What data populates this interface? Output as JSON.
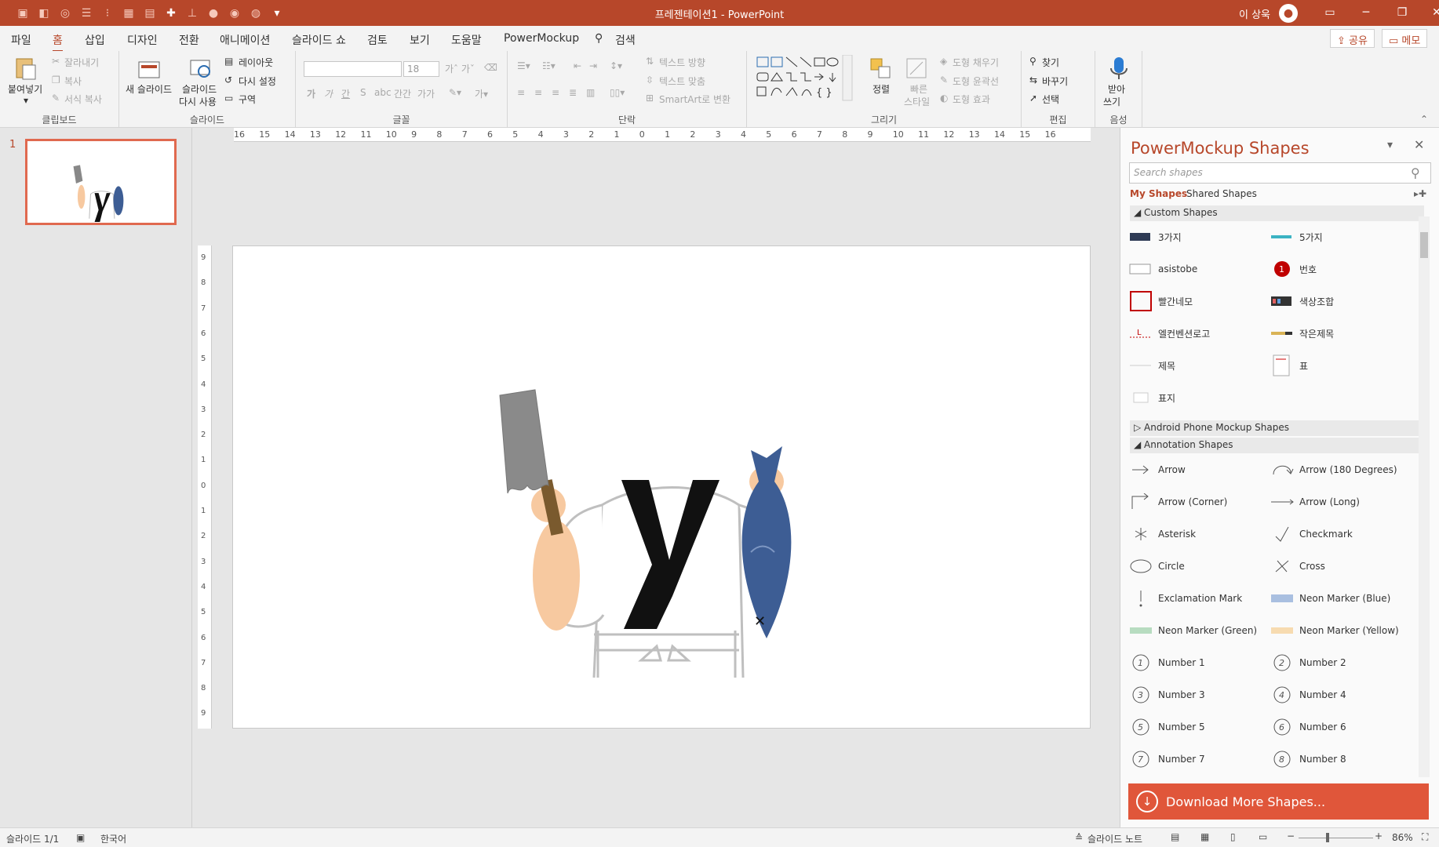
{
  "title": "프레젠테이션1  -  PowerPoint",
  "user": "이 상욱",
  "colors": {
    "accent": "#b7472a",
    "download_bg": "#e0563a"
  },
  "menu": {
    "items": [
      "파일",
      "홈",
      "삽입",
      "디자인",
      "전환",
      "애니메이션",
      "슬라이드 쇼",
      "검토",
      "보기",
      "도움말",
      "PowerMockup"
    ],
    "search": "검색",
    "share": "공유",
    "memo": "메모"
  },
  "ribbon": {
    "clipboard": {
      "label": "클립보드",
      "paste": "붙여넣기",
      "cut": "잘라내기",
      "copy": "복사",
      "format_painter": "서식 복사"
    },
    "slides": {
      "label": "슬라이드",
      "new_slide": "새 슬라이드",
      "reuse_line1": "슬라이드",
      "reuse_line2": "다시 사용",
      "layout": "레이아웃",
      "reset": "다시 설정",
      "section": "구역"
    },
    "font": {
      "label": "글꼴",
      "size": "18"
    },
    "paragraph": {
      "label": "단락",
      "text_direction": "텍스트 방향",
      "align_text": "텍스트 맞춤",
      "smartart": "SmartArt로 변환"
    },
    "drawing": {
      "label": "그리기",
      "arrange": "정렬",
      "quick_styles_line1": "빠른",
      "quick_styles_line2": "스타일",
      "shape_fill": "도형 채우기",
      "shape_outline": "도형 윤곽선",
      "shape_effects": "도형 효과"
    },
    "editing": {
      "label": "편집",
      "find": "찾기",
      "replace": "바꾸기",
      "select": "선택"
    },
    "voice": {
      "label": "음성",
      "dictate_line1": "받아",
      "dictate_line2": "쓰기"
    }
  },
  "thumbnail": {
    "number": "1"
  },
  "ruler": {
    "h_labels": [
      "16",
      "15",
      "14",
      "13",
      "12",
      "11",
      "10",
      "9",
      "8",
      "7",
      "6",
      "5",
      "4",
      "3",
      "2",
      "1",
      "0",
      "1",
      "2",
      "3",
      "4",
      "5",
      "6",
      "7",
      "8",
      "9",
      "10",
      "11",
      "12",
      "13",
      "14",
      "15",
      "16"
    ],
    "v_labels": [
      "9",
      "8",
      "7",
      "6",
      "5",
      "4",
      "3",
      "2",
      "1",
      "0",
      "1",
      "2",
      "3",
      "4",
      "5",
      "6",
      "7",
      "8",
      "9"
    ]
  },
  "panel": {
    "title": "PowerMockup Shapes",
    "search_placeholder": "Search shapes",
    "tab_my": "My Shapes",
    "tab_shared": "Shared Shapes",
    "section_custom": "Custom Shapes",
    "section_android": "Android Phone Mockup Shapes",
    "section_annotation": "Annotation Shapes",
    "custom": [
      "3가지",
      "5가지",
      "asistobe",
      "번호",
      "빨간네모",
      "색상조합",
      "엘컨벤션로고",
      "작은제목",
      "제목",
      "표",
      "표지"
    ],
    "annotation": [
      "Arrow",
      "Arrow (180 Degrees)",
      "Arrow (Corner)",
      "Arrow (Long)",
      "Asterisk",
      "Checkmark",
      "Circle",
      "Cross",
      "Exclamation Mark",
      "Neon Marker (Blue)",
      "Neon Marker (Green)",
      "Neon Marker (Yellow)",
      "Number 1",
      "Number 2",
      "Number 3",
      "Number 4",
      "Number 5",
      "Number 6",
      "Number 7",
      "Number 8"
    ],
    "download": "Download More Shapes..."
  },
  "status": {
    "slide": "슬라이드 1/1",
    "language": "한국어",
    "notes": "슬라이드 노트",
    "zoom": "86%"
  }
}
